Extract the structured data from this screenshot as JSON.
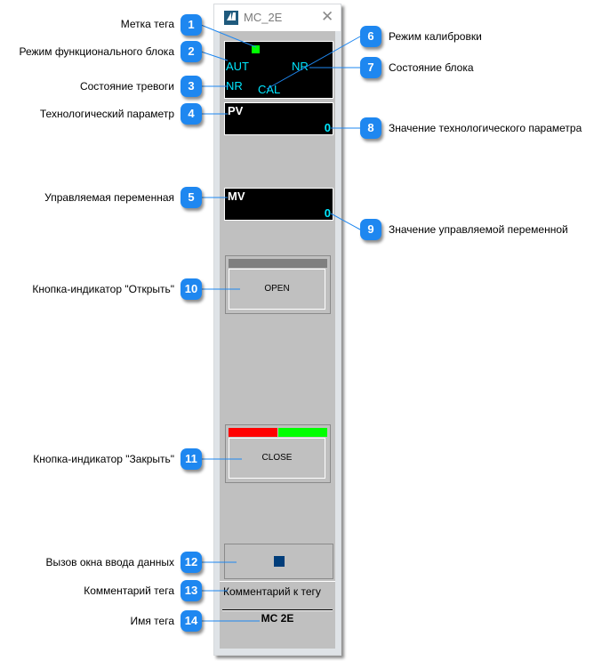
{
  "window": {
    "title": "MC_2E",
    "icon": "app-logo-icon",
    "close_icon": "close-icon",
    "close_glyph": "✕"
  },
  "faceplate": {
    "status": {
      "tag_mark_color": "#00ff00",
      "mode": "AUT",
      "block_state": "NR",
      "alarm_state": "NR",
      "calibration": "CAL"
    },
    "pv": {
      "label": "PV",
      "value": "0"
    },
    "mv": {
      "label": "MV",
      "value": "0"
    },
    "open_button": {
      "label": "OPEN",
      "indicator": "gray"
    },
    "close_button": {
      "label": "CLOSE",
      "indicator_left": "#ff0000",
      "indicator_right": "#00ff00"
    },
    "data_entry_button": {
      "icon": "square-icon",
      "color": "#003d7a"
    },
    "comment": "Комментарий к тегу",
    "tag_name": "MC  2E"
  },
  "callouts": [
    {
      "num": "1",
      "label": "Метка тега"
    },
    {
      "num": "2",
      "label": "Режим функционального блока"
    },
    {
      "num": "3",
      "label": "Состояние тревоги"
    },
    {
      "num": "4",
      "label": "Технологический параметр"
    },
    {
      "num": "5",
      "label": "Управляемая переменная"
    },
    {
      "num": "6",
      "label": "Режим калибровки"
    },
    {
      "num": "7",
      "label": "Состояние блока"
    },
    {
      "num": "8",
      "label": "Значение технологического параметра"
    },
    {
      "num": "9",
      "label": "Значение управляемой переменной"
    },
    {
      "num": "10",
      "label": "Кнопка-индикатор \"Открыть\""
    },
    {
      "num": "11",
      "label": "Кнопка-индикатор \"Закрыть\""
    },
    {
      "num": "12",
      "label": "Вызов окна ввода данных"
    },
    {
      "num": "13",
      "label": "Комментарий тега"
    },
    {
      "num": "14",
      "label": "Имя тега"
    }
  ],
  "colors": {
    "badge": "#1e87f0",
    "leader_line": "#1e87f0",
    "display_text": "#00e8ff",
    "panel": "#c0c0c0"
  }
}
